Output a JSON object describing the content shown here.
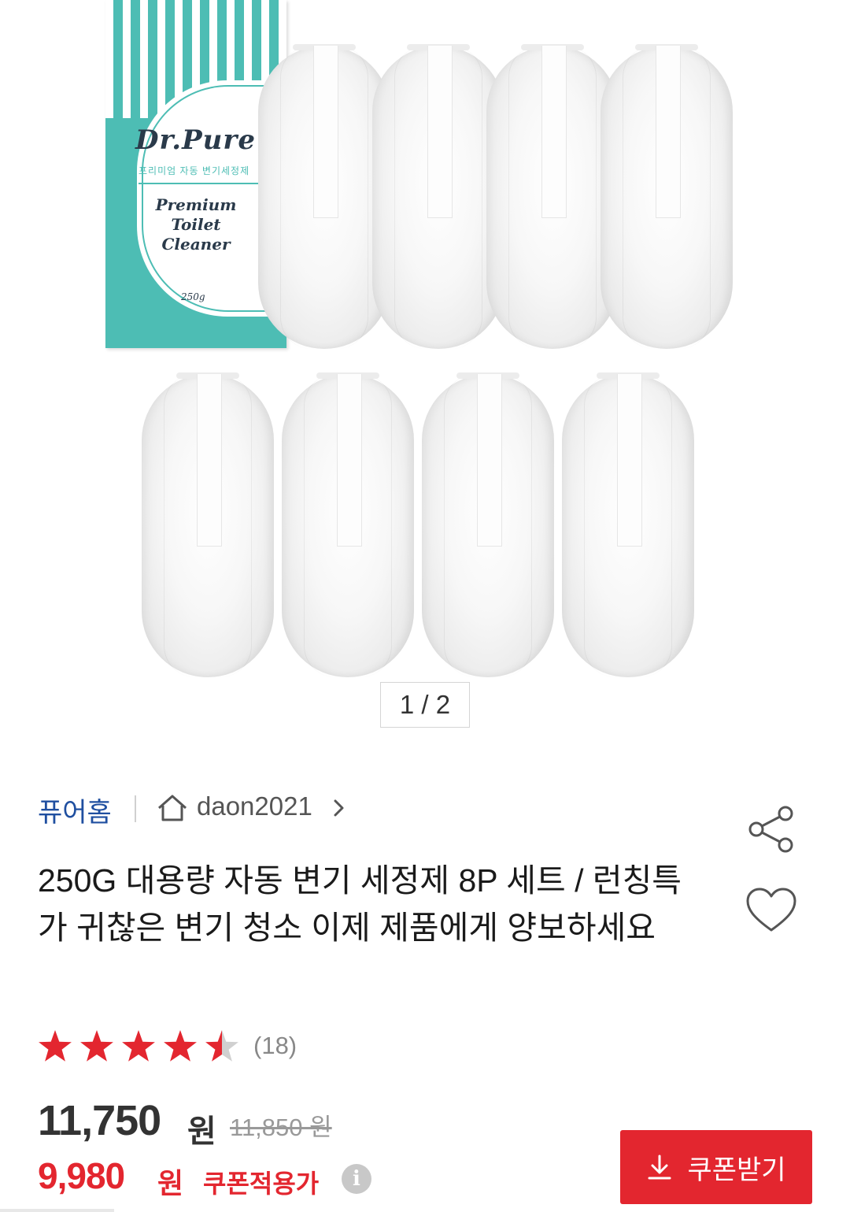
{
  "image": {
    "box_brand": "Dr.Pure",
    "box_subtitle": "프리미엄 자동 변기세정제",
    "box_product": "Premium Toilet Cleaner",
    "box_weight": "250g",
    "pager": "1 / 2"
  },
  "seller": {
    "shop_name": "퓨어홈",
    "seller_id": "daon2021"
  },
  "product": {
    "title": "250G 대용량 자동 변기 세정제 8P 세트 / 런칭특가 귀찮은 변기 청소 이제 제품에게 양보하세요",
    "rating": 4.5,
    "review_count": "(18)"
  },
  "pricing": {
    "price": "11,750",
    "price_unit": "원",
    "original_price": "11,850 원",
    "coupon_price": "9,980",
    "coupon_unit": "원",
    "coupon_label": "쿠폰적용가",
    "coupon_button": "쿠폰받기",
    "info_glyph": "i"
  },
  "colors": {
    "accent_red": "#e3262f",
    "link_blue": "#1f4fa0",
    "box_teal": "#4dbdb4"
  },
  "icons": [
    "home-icon",
    "chevron-right-icon",
    "share-icon",
    "heart-icon",
    "star-icon",
    "info-icon",
    "download-icon"
  ]
}
